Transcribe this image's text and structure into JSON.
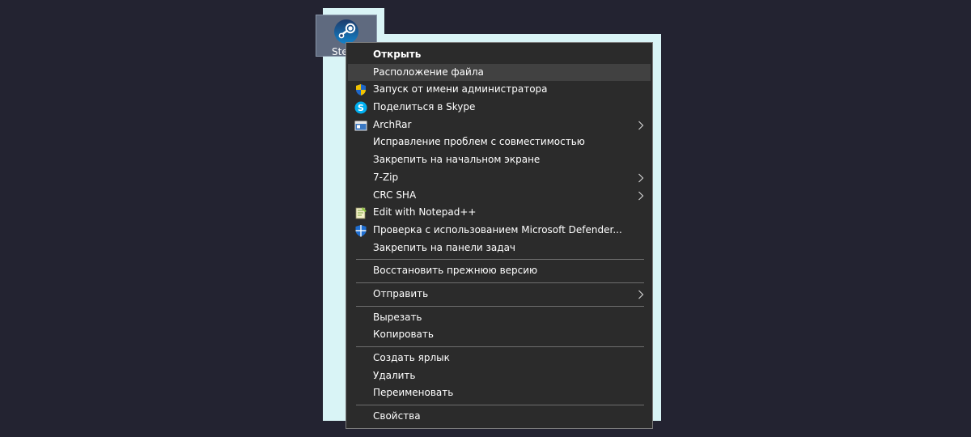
{
  "desktop": {
    "icon_label": "Steam",
    "icon_name": "steam-icon"
  },
  "colors": {
    "desktop_background": "#232331",
    "highlight_glow": "#d9f4f6",
    "menu_background": "#2b2b2b",
    "menu_hover": "#414141",
    "menu_text": "#ffffff"
  },
  "menu": {
    "items": [
      {
        "label": "Открыть",
        "bold": true
      },
      {
        "label": "Расположение файла",
        "highlighted": true
      },
      {
        "label": "Запуск от имени администратора",
        "icon": "uac-shield-icon"
      },
      {
        "label": "Поделиться в Skype",
        "icon": "skype-icon"
      },
      {
        "label": "ArchRar",
        "icon": "archive-icon",
        "submenu": true
      },
      {
        "label": "Исправление проблем с совместимостью"
      },
      {
        "label": "Закрепить на начальном экране"
      },
      {
        "label": "7-Zip",
        "submenu": true
      },
      {
        "label": "CRC SHA",
        "submenu": true
      },
      {
        "label": "Edit with Notepad++",
        "icon": "notepad-plus-plus-icon"
      },
      {
        "label": "Проверка с использованием Microsoft Defender...",
        "icon": "defender-shield-icon"
      },
      {
        "label": "Закрепить на панели задач"
      },
      {
        "label": "Восстановить прежнюю версию"
      },
      {
        "label": "Отправить",
        "submenu": true
      },
      {
        "label": "Вырезать"
      },
      {
        "label": "Копировать"
      },
      {
        "label": "Создать ярлык"
      },
      {
        "label": "Удалить"
      },
      {
        "label": "Переименовать"
      },
      {
        "label": "Свойства"
      }
    ]
  }
}
